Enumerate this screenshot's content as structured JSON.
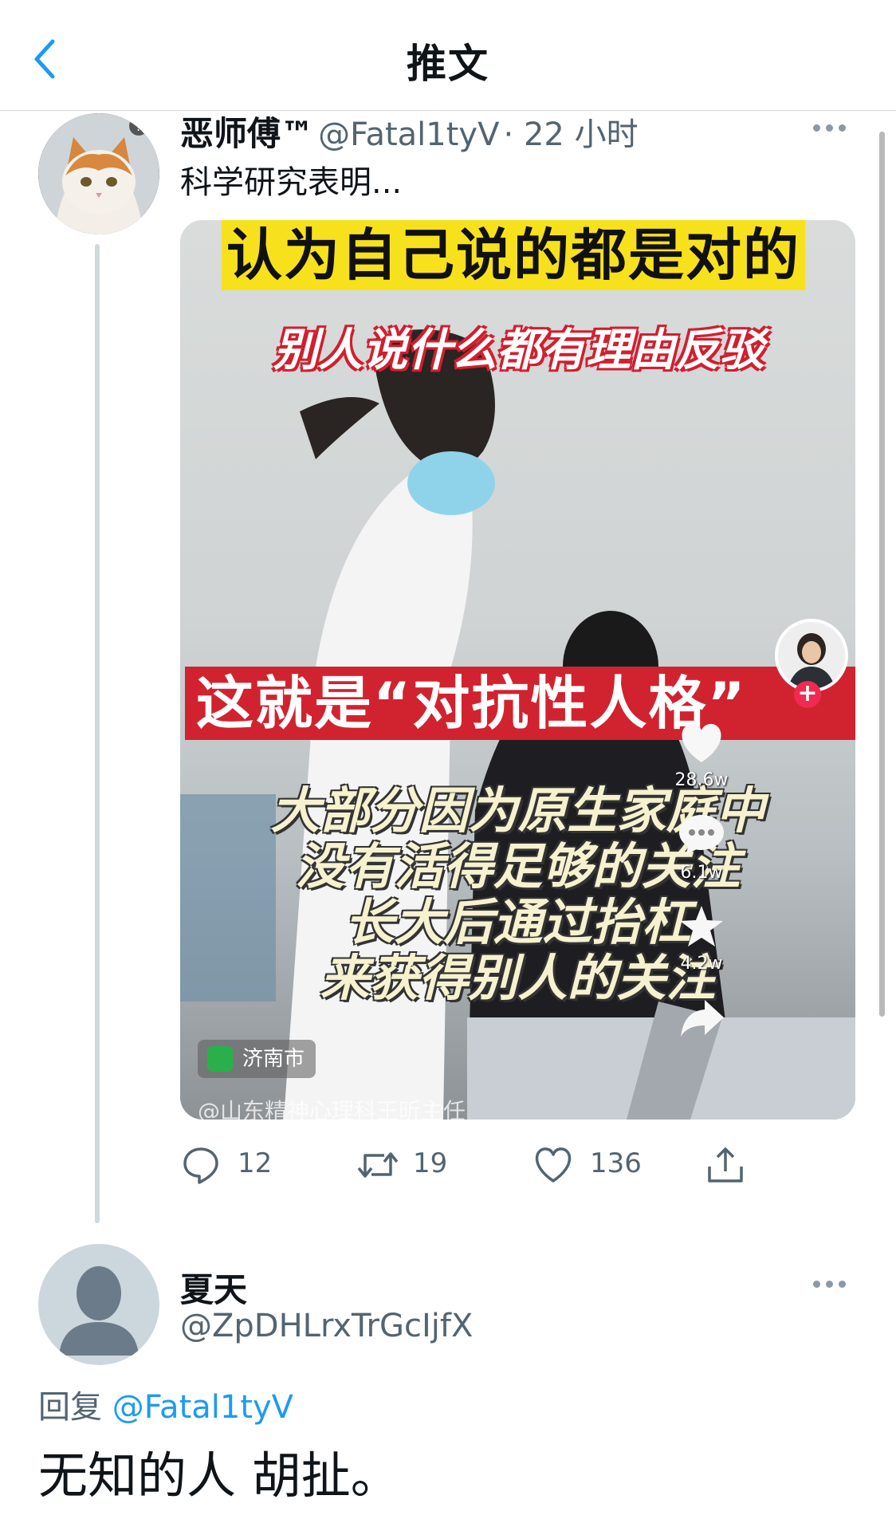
{
  "header": {
    "title": "推文",
    "back_icon": "chevron-left-icon",
    "accent": "#1d9bf0"
  },
  "tweet": {
    "display_name": "恶师傅™",
    "handle": "@Fatal1tyV",
    "time": "· 22 小时",
    "text": "科学研究表明...",
    "media": {
      "caption_top": "认为自己说的都是对的",
      "caption_second": "别人说什么都有理由反驳",
      "caption_banner": "这就是“对抗性人格”",
      "caption_lines": [
        "大部分因为原生家庭中",
        "没有活得足够的关注",
        "长大后通过抬杠",
        "来获得别人的关注"
      ],
      "location": "济南市",
      "watermark": "@山东精神心理科王昕主任",
      "likes": "28.6w",
      "comments": "6.1w",
      "favorites": "4.2w"
    },
    "actions": {
      "replies": "12",
      "retweets": "19",
      "likes": "136"
    }
  },
  "reply": {
    "display_name": "夏天",
    "handle": "@ZpDHLrxTrGcIjfX",
    "reply_prefix": "回复",
    "reply_mention": "@Fatal1tyV",
    "text": "无知的人 胡扯。"
  }
}
